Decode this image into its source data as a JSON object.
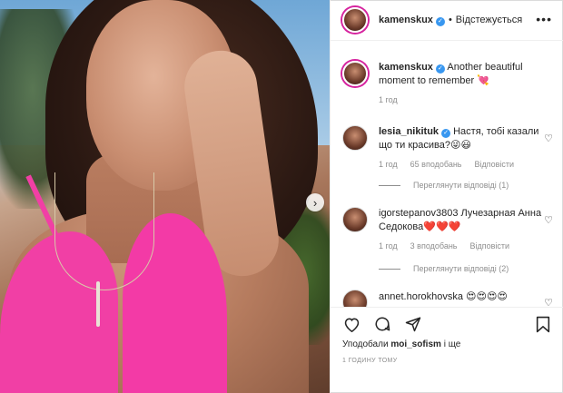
{
  "post": {
    "username": "kamenskux",
    "follow_status": "Відстежується",
    "more_icon": "more-horizontal-icon"
  },
  "caption": {
    "username": "kamenskux",
    "text": "Another beautiful moment to remember 💘",
    "time": "1 год"
  },
  "comments": [
    {
      "username": "lesia_nikituk",
      "verified": true,
      "text": "Настя, тобі казали що ти красива?😜😃",
      "time": "1 год",
      "likes": "65 вподобань",
      "reply_label": "Відповісти",
      "view_replies": "Переглянути відповіді (1)"
    },
    {
      "username": "igorstepanov3803",
      "verified": false,
      "text": "Лучезарная Анна Седокова❤️❤️❤️",
      "time": "1 год",
      "likes": "3 вподобань",
      "reply_label": "Відповісти",
      "view_replies": "Переглянути відповіді (2)"
    },
    {
      "username": "annet.horokhovska",
      "verified": false,
      "text": "😍😍😍😍",
      "time": "",
      "likes": "",
      "reply_label": "",
      "view_replies": ""
    }
  ],
  "actions": {
    "icons": [
      "heart-icon",
      "comment-icon",
      "share-icon",
      "bookmark-icon"
    ]
  },
  "likes_summary": {
    "prefix": "Уподобали",
    "user": "moi_sofism",
    "suffix": "і ще"
  },
  "timestamp": "1 ГОДИНУ ТОМУ",
  "colors": {
    "verified": "#3897f0",
    "story_ring": "#d6249f",
    "muted_text": "#8e8e8e"
  }
}
